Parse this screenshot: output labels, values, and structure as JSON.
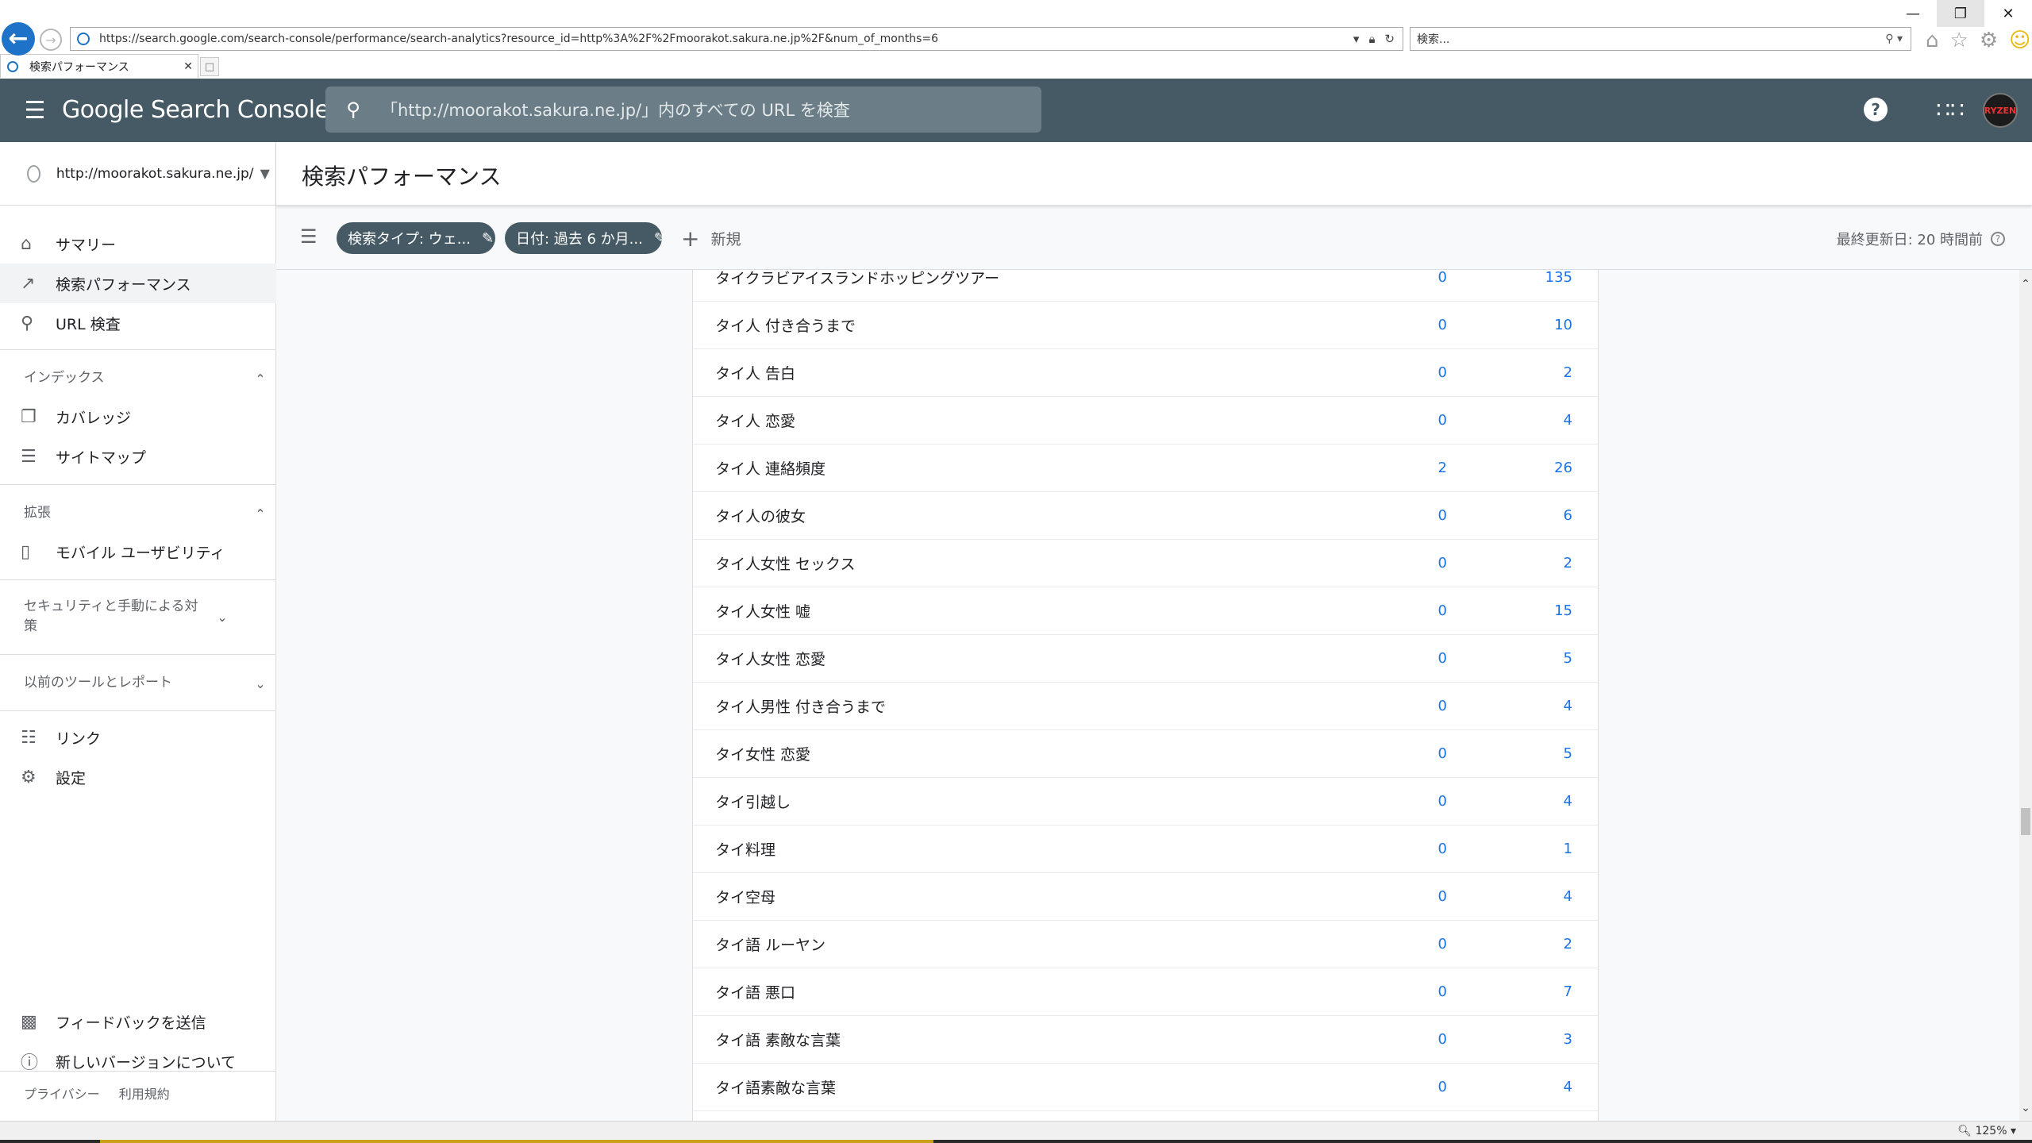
{
  "browser": {
    "url": "https://search.google.com/search-console/performance/search-analytics?resource_id=http%3A%2F%2Fmoorakot.sakura.ne.jp%2F&num_of_months=6",
    "search_placeholder": "検索...",
    "tab_title": "検索パフォーマンス",
    "zoom": "125%"
  },
  "header": {
    "app_title": "Google Search Console",
    "inspect_placeholder": "「http://moorakot.sakura.ne.jp/」内のすべての URL を検査",
    "avatar_text": "RYZEN"
  },
  "sidebar": {
    "property": "http://moorakot.sakura.ne.jp/",
    "summary": "サマリー",
    "performance": "検索パフォーマンス",
    "url_inspection": "URL 検査",
    "index_section": "インデックス",
    "coverage": "カバレッジ",
    "sitemaps": "サイトマップ",
    "enhancements_section": "拡張",
    "mobile_usability": "モバイル ユーザビリティ",
    "security_section": "セキュリティと手動による対策",
    "legacy_section": "以前のツールとレポート",
    "links": "リンク",
    "settings": "設定",
    "feedback": "フィードバックを送信",
    "about_new": "新しいバージョンについて",
    "privacy": "プライバシー",
    "terms": "利用規約"
  },
  "main": {
    "page_title": "検索パフォーマンス",
    "chip_search_type": "検索タイプ: ウェ...",
    "chip_date": "日付: 過去 6 か月...",
    "new_label": "新規",
    "last_updated": "最終更新日: 20 時間前"
  },
  "table": {
    "rows": [
      {
        "query": "タイクラビアイスランドホッピングツアー",
        "clicks": "0",
        "impressions": "135"
      },
      {
        "query": "タイ人 付き合うまで",
        "clicks": "0",
        "impressions": "10"
      },
      {
        "query": "タイ人 告白",
        "clicks": "0",
        "impressions": "2"
      },
      {
        "query": "タイ人 恋愛",
        "clicks": "0",
        "impressions": "4"
      },
      {
        "query": "タイ人 連絡頻度",
        "clicks": "2",
        "impressions": "26"
      },
      {
        "query": "タイ人の彼女",
        "clicks": "0",
        "impressions": "6"
      },
      {
        "query": "タイ人女性 セックス",
        "clicks": "0",
        "impressions": "2"
      },
      {
        "query": "タイ人女性 嘘",
        "clicks": "0",
        "impressions": "15"
      },
      {
        "query": "タイ人女性 恋愛",
        "clicks": "0",
        "impressions": "5"
      },
      {
        "query": "タイ人男性 付き合うまで",
        "clicks": "0",
        "impressions": "4"
      },
      {
        "query": "タイ女性 恋愛",
        "clicks": "0",
        "impressions": "5"
      },
      {
        "query": "タイ引越し",
        "clicks": "0",
        "impressions": "4"
      },
      {
        "query": "タイ料理",
        "clicks": "0",
        "impressions": "1"
      },
      {
        "query": "タイ空母",
        "clicks": "0",
        "impressions": "4"
      },
      {
        "query": "タイ語 ルーヤン",
        "clicks": "0",
        "impressions": "2"
      },
      {
        "query": "タイ語 悪口",
        "clicks": "0",
        "impressions": "7"
      },
      {
        "query": "タイ語 素敵な言葉",
        "clicks": "0",
        "impressions": "3"
      },
      {
        "query": "タイ語素敵な言葉",
        "clicks": "0",
        "impressions": "4"
      }
    ]
  },
  "colors": {
    "header_bg": "#455a64",
    "link_blue": "#1a73e8",
    "active_nav_bg": "#f1f3f4"
  }
}
